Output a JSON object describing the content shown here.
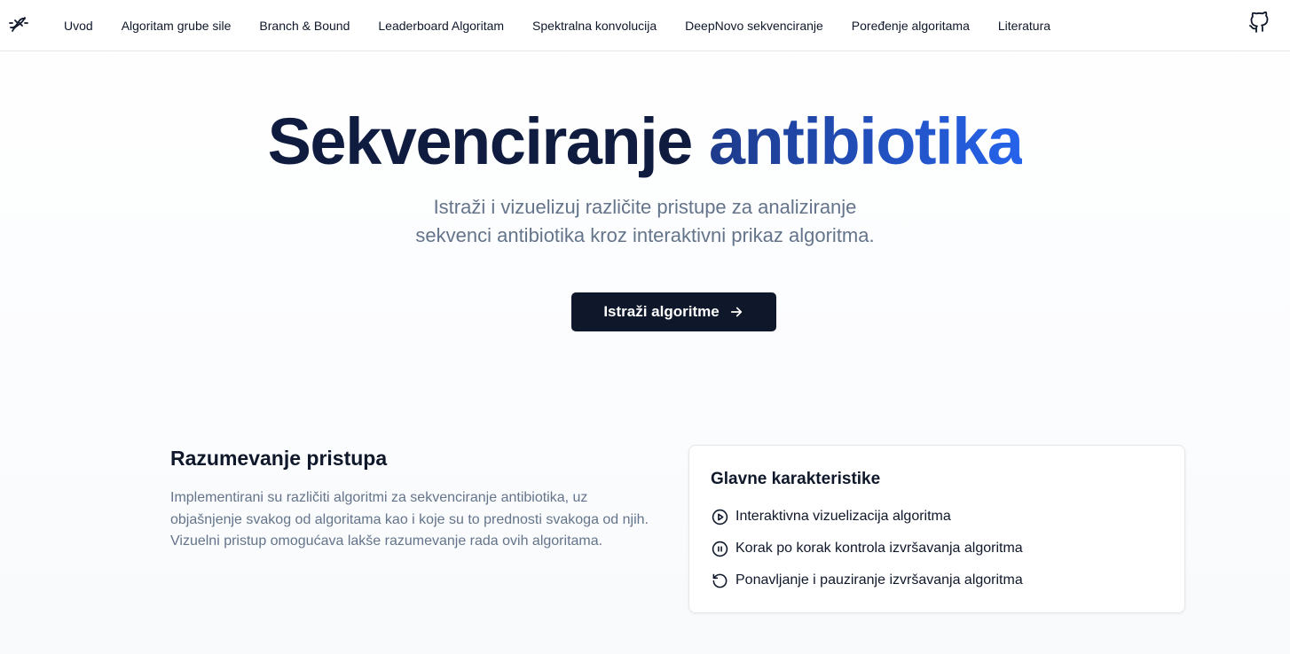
{
  "nav": {
    "logo_icon": "dna-icon",
    "links": [
      "Uvod",
      "Algoritam grube sile",
      "Branch & Bound",
      "Leaderboard Algoritam",
      "Spektralna konvolucija",
      "DeepNovo sekvenciranje",
      "Poređenje algoritama",
      "Literatura"
    ],
    "github_icon": "github-icon"
  },
  "hero": {
    "title_part1": "Sekvenciranje",
    "title_part2": "antibiotika",
    "subtitle_line1": "Istraži i vizuelizuj različite pristupe za analiziranje",
    "subtitle_line2": "sekvenci antibiotika kroz interaktivni prikaz algoritma.",
    "cta_label": "Istraži algoritme"
  },
  "approach": {
    "heading": "Razumevanje pristupa",
    "text": "Implementirani su različiti algoritmi za sekvenciranje antibiotika, uz objašnjenje svakog od algoritama kao i koje su to prednosti svakoga od njih. Vizuelni pristup omogućava lakše razumevanje rada ovih algoritama."
  },
  "features": {
    "title": "Glavne karakteristike",
    "items": [
      {
        "icon": "play-circle-icon",
        "label": "Interaktivna vizuelizacija algoritma"
      },
      {
        "icon": "pause-circle-icon",
        "label": "Korak po korak kontrola izvršavanja algoritma"
      },
      {
        "icon": "rotate-ccw-icon",
        "label": "Ponavljanje i pauziranje izvršavanja algoritma"
      }
    ]
  },
  "colors": {
    "primary_dark": "#0f172a",
    "accent_blue": "#2563eb",
    "muted_text": "#64748b",
    "border": "#e5e7eb"
  }
}
